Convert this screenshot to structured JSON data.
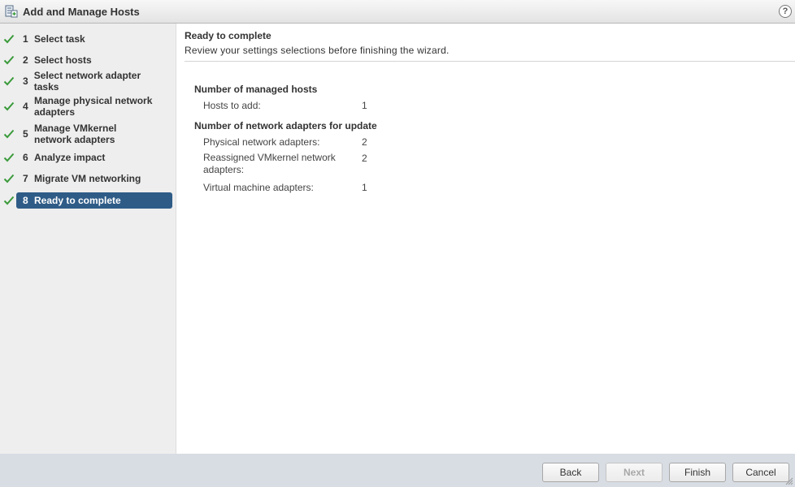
{
  "window": {
    "title": "Add and Manage Hosts",
    "help": "?"
  },
  "steps": [
    {
      "num": "1",
      "label": "Select task"
    },
    {
      "num": "2",
      "label": "Select hosts"
    },
    {
      "num": "3",
      "label": "Select network adapter tasks"
    },
    {
      "num": "4",
      "label": "Manage physical network adapters"
    },
    {
      "num": "5",
      "label": "Manage VMkernel network adapters"
    },
    {
      "num": "6",
      "label": "Analyze impact"
    },
    {
      "num": "7",
      "label": "Migrate VM networking"
    },
    {
      "num": "8",
      "label": "Ready to complete"
    }
  ],
  "page": {
    "title": "Ready to complete",
    "subtitle": "Review your settings selections before finishing the wizard."
  },
  "summary": {
    "managed_hosts": {
      "heading": "Number of managed hosts",
      "rows": [
        {
          "label": "Hosts to add:",
          "value": "1"
        }
      ]
    },
    "network_adapters": {
      "heading": "Number of network adapters for update",
      "rows": [
        {
          "label": "Physical network adapters:",
          "value": "2"
        },
        {
          "label": "Reassigned VMkernel network adapters:",
          "value": "2"
        },
        {
          "label": "Virtual machine adapters:",
          "value": "1"
        }
      ]
    }
  },
  "buttons": {
    "back": "Back",
    "next": "Next",
    "finish": "Finish",
    "cancel": "Cancel"
  },
  "colors": {
    "active_step": "#2f5c87",
    "check": "#3a9a3a"
  }
}
